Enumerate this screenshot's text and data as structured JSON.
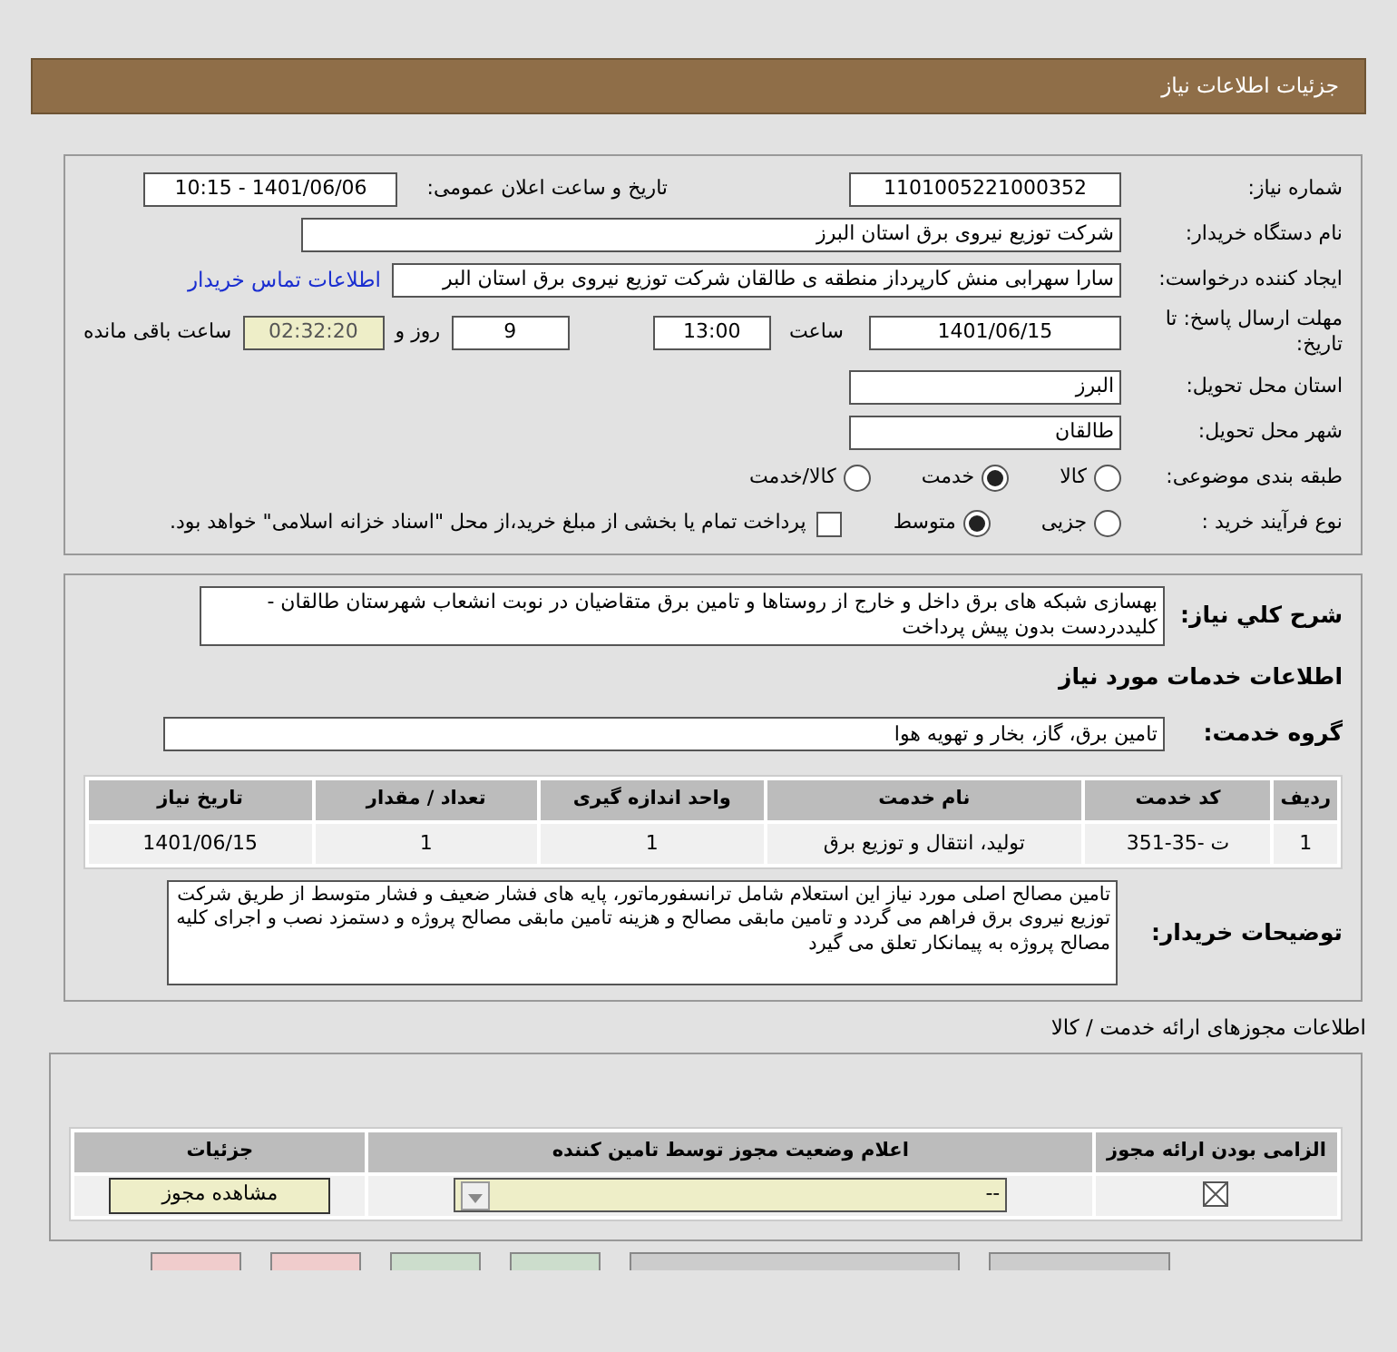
{
  "header": {
    "title": "جزئیات اطلاعات نیاز"
  },
  "details": {
    "need_number": {
      "label": "شماره نیاز:",
      "value": "1101005221000352"
    },
    "announce": {
      "label": "تاریخ و ساعت اعلان عمومی:",
      "value": "1401/06/06 - 10:15"
    },
    "buyer": {
      "label": "نام دستگاه خریدار:",
      "value": "شرکت توزیع نیروی برق استان البرز"
    },
    "requester": {
      "label": "ایجاد کننده درخواست:",
      "value": "سارا سهرابی منش کارپرداز منطقه ی طالقان شرکت توزیع نیروی برق استان البر",
      "link": "اطلاعات تماس خریدار"
    },
    "deadline": {
      "label": "مهلت ارسال پاسخ: تا تاریخ:",
      "date": "1401/06/15",
      "time_label": "ساعت",
      "time": "13:00",
      "days": "9",
      "days_label": "روز و",
      "remaining": "02:32:20",
      "remaining_label": "ساعت باقی مانده"
    },
    "province": {
      "label": "استان محل تحویل:",
      "value": "البرز"
    },
    "city": {
      "label": "شهر محل تحویل:",
      "value": "طالقان"
    },
    "category": {
      "label": "طبقه بندی موضوعی:",
      "options": [
        {
          "label": "کالا",
          "selected": false
        },
        {
          "label": "خدمت",
          "selected": true
        },
        {
          "label": "کالا/خدمت",
          "selected": false
        }
      ]
    },
    "process": {
      "label": "نوع فرآیند خرید :",
      "options": [
        {
          "label": "جزیی",
          "selected": false
        },
        {
          "label": "متوسط",
          "selected": true
        }
      ],
      "payment": {
        "label": "پرداخت تمام یا بخشی از مبلغ خرید،از محل \"اسناد خزانه اسلامی\" خواهد بود.",
        "checked": false
      }
    }
  },
  "summary": {
    "label": "شرح کلي نياز:",
    "value": "بهسازی شبکه های برق داخل و خارج از روستاها و تامین برق متقاضیان در نوبت انشعاب شهرستان طالقان - کلیددردست بدون پیش پرداخت"
  },
  "services_title": "اطلاعات خدمات مورد نیاز",
  "service_group": {
    "label": "گروه خدمت:",
    "value": "تامین برق، گاز، بخار و تهویه هوا"
  },
  "services_table": {
    "columns": [
      "ردیف",
      "کد خدمت",
      "نام خدمت",
      "واحد اندازه گیری",
      "تعداد / مقدار",
      "تاریخ نیاز"
    ],
    "rows": [
      [
        "1",
        "ت -35-351",
        "تولید، انتقال و توزیع برق",
        "1",
        "1",
        "1401/06/15"
      ]
    ]
  },
  "buyer_notes": {
    "label": "توضیحات خریدار:",
    "value": "تامین مصالح اصلی مورد نیاز این استعلام شامل ترانسفورماتور، پایه های فشار ضعیف و فشار متوسط  از طریق شرکت توزیع نیروی برق فراهم می گردد و تامین مابقی مصالح و هزینه تامین مابقی مصالح پروژه و دستمزد نصب و اجرای کلیه مصالح پروژه به پیمانکار تعلق می گیرد"
  },
  "licenses_title": "اطلاعات مجوزهای ارائه خدمت / کالا",
  "licenses_table": {
    "columns": [
      "الزامی بودن ارائه مجوز",
      "اعلام وضعیت مجوز توسط تامین کننده",
      "جزئیات"
    ],
    "rows": [
      {
        "required": true,
        "status": "--",
        "button": "مشاهده مجوز"
      }
    ]
  },
  "footer_buttons": [
    {
      "color": "#cccccc"
    },
    {
      "color": "#cccccc"
    },
    {
      "color": "#ccddcc"
    },
    {
      "color": "#ccddcc"
    },
    {
      "color": "#f0cccc"
    },
    {
      "color": "#f0cccc"
    }
  ]
}
